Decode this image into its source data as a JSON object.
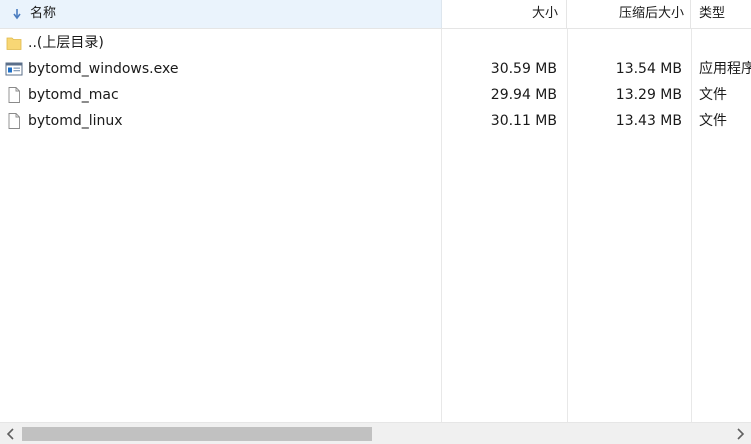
{
  "header": {
    "name_label": "名称",
    "size_label": "大小",
    "compressed_label": "压缩后大小",
    "type_label": "类型"
  },
  "files": [
    {
      "name": "..(上层目录)",
      "size": "",
      "compressed": "",
      "type": "",
      "icon": "folder-icon"
    },
    {
      "name": "bytomd_windows.exe",
      "size": "30.59 MB",
      "compressed": "13.54 MB",
      "type": "应用程序",
      "icon": "exe-icon"
    },
    {
      "name": "bytomd_mac",
      "size": "29.94 MB",
      "compressed": "13.29 MB",
      "type": "文件",
      "icon": "file-icon"
    },
    {
      "name": "bytomd_linux",
      "size": "30.11 MB",
      "compressed": "13.43 MB",
      "type": "文件",
      "icon": "file-icon"
    }
  ],
  "colors": {
    "header_active": "#eaf3fc",
    "folder": "#f8d775",
    "exe_accent": "#1e6fc7",
    "scrollbar_thumb": "#c1c1c1"
  }
}
